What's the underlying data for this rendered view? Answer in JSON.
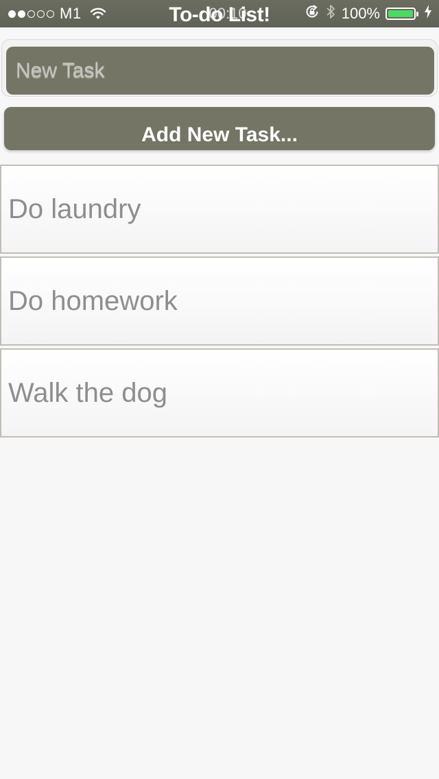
{
  "status_bar": {
    "carrier": "M1",
    "signal_filled": 2,
    "signal_total": 5,
    "title": "To-do List!",
    "time": "00:10",
    "battery_percent": "100%",
    "battery_level": 1.0,
    "battery_color": "#4cd964"
  },
  "new_task": {
    "placeholder": "New Task",
    "value": ""
  },
  "add_button": {
    "label": "Add New Task..."
  },
  "tasks": [
    {
      "label": "Do laundry"
    },
    {
      "label": "Do homework"
    },
    {
      "label": "Walk the dog"
    }
  ],
  "colors": {
    "header_bg": "#5f6256",
    "control_bg": "#747565",
    "page_bg": "#f7f7f7",
    "task_text": "#8e8e8e"
  }
}
